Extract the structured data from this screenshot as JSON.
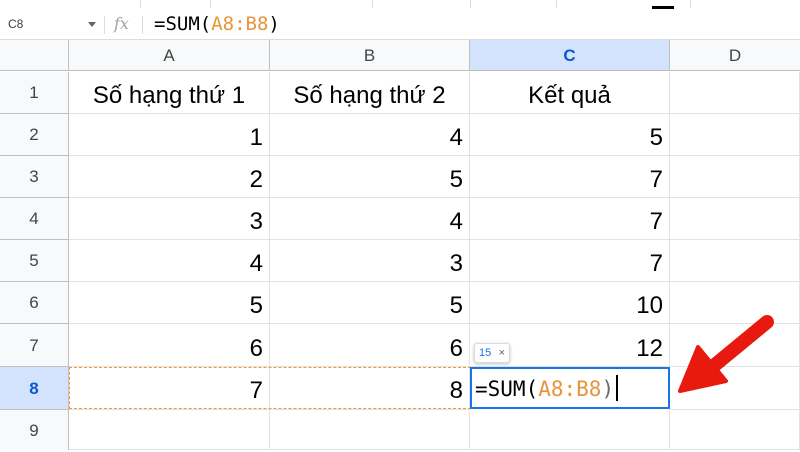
{
  "formula_bar": {
    "name_box": "C8",
    "fx_label": "fx",
    "formula_prefix": "=SUM(",
    "formula_range": "A8:B8",
    "formula_suffix": ")"
  },
  "columns": [
    "A",
    "B",
    "C",
    "D"
  ],
  "rows": [
    "1",
    "2",
    "3",
    "4",
    "5",
    "6",
    "7",
    "8",
    "9"
  ],
  "headers": {
    "a": "Số hạng thứ 1",
    "b": "Số hạng thứ 2",
    "c": "Kết quả"
  },
  "data_rows": [
    {
      "a": "1",
      "b": "4",
      "c": "5"
    },
    {
      "a": "2",
      "b": "5",
      "c": "7"
    },
    {
      "a": "3",
      "b": "4",
      "c": "7"
    },
    {
      "a": "4",
      "b": "3",
      "c": "7"
    },
    {
      "a": "5",
      "b": "5",
      "c": "10"
    },
    {
      "a": "6",
      "b": "6",
      "c": "12"
    },
    {
      "a": "7",
      "b": "8",
      "c": ""
    }
  ],
  "editing_cell": {
    "prefix": "=SUM(",
    "range": "A8:B8",
    "suffix": ")"
  },
  "tooltip": {
    "value": "15",
    "close": "×"
  },
  "colors": {
    "accent": "#1a73e8",
    "range_highlight": "#f29a32",
    "arrow": "#e8190e"
  }
}
